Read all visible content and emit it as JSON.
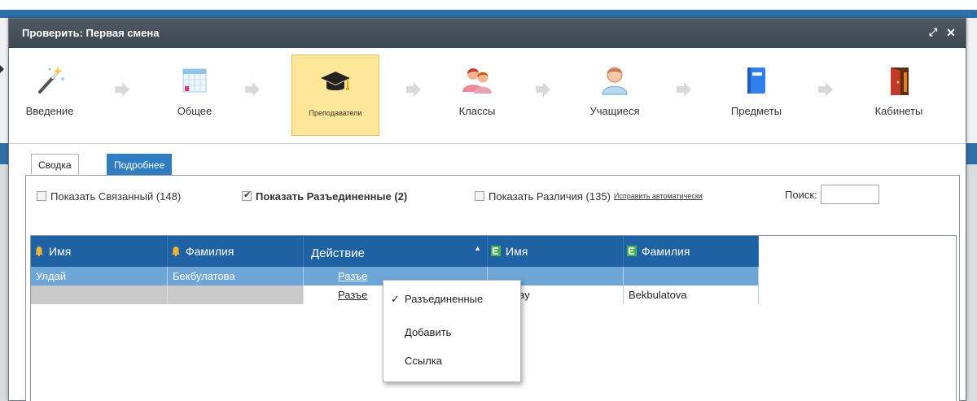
{
  "dialog": {
    "title": "Проверить: Первая смена"
  },
  "wizard": {
    "steps": [
      {
        "label": "Введение",
        "icon": "magic-wand-icon"
      },
      {
        "label": "Общее",
        "icon": "calendar-grid-icon"
      },
      {
        "label": "Преподаватели",
        "icon": "graduation-cap-icon"
      },
      {
        "label": "Классы",
        "icon": "group-icon"
      },
      {
        "label": "Учащиеся",
        "icon": "person-icon"
      },
      {
        "label": "Предметы",
        "icon": "book-icon"
      },
      {
        "label": "Кабинеты",
        "icon": "door-icon"
      }
    ],
    "active_step": "Преподаватели"
  },
  "tabs": [
    {
      "label": "Сводка",
      "active": false
    },
    {
      "label": "Подробнее",
      "active": true
    }
  ],
  "options": {
    "show_linked": "Показать Связанный (148)",
    "show_linked_checked": false,
    "show_unlinked": "Показать Разъединенные (2)",
    "show_unlinked_checked": true,
    "show_diff": "Показать Различия (135)",
    "show_diff_checked": false,
    "fix_auto": "Исправить автоматически",
    "search_label": "Поиск:",
    "search_value": ""
  },
  "grid": {
    "columns": [
      "Имя",
      "Фамилия",
      "Действие",
      "Имя",
      "Фамилия"
    ],
    "rows": [
      [
        "Улдай",
        "Бекбулатова",
        "Разъе",
        "",
        ""
      ],
      [
        "",
        "",
        "Разъе",
        "ay",
        "Bekbulatova"
      ]
    ]
  },
  "context_menu": {
    "items": [
      "Разъединенные",
      "Добавить",
      "Ссылка"
    ],
    "checked_item": "Разъединенные",
    "check_mark": "✓"
  },
  "colors": {
    "header_blue": "#1e62a3",
    "selected_row": "#6fa6d8",
    "active_step_bg": "#ffe79a",
    "title_bar": "#3d474f"
  }
}
